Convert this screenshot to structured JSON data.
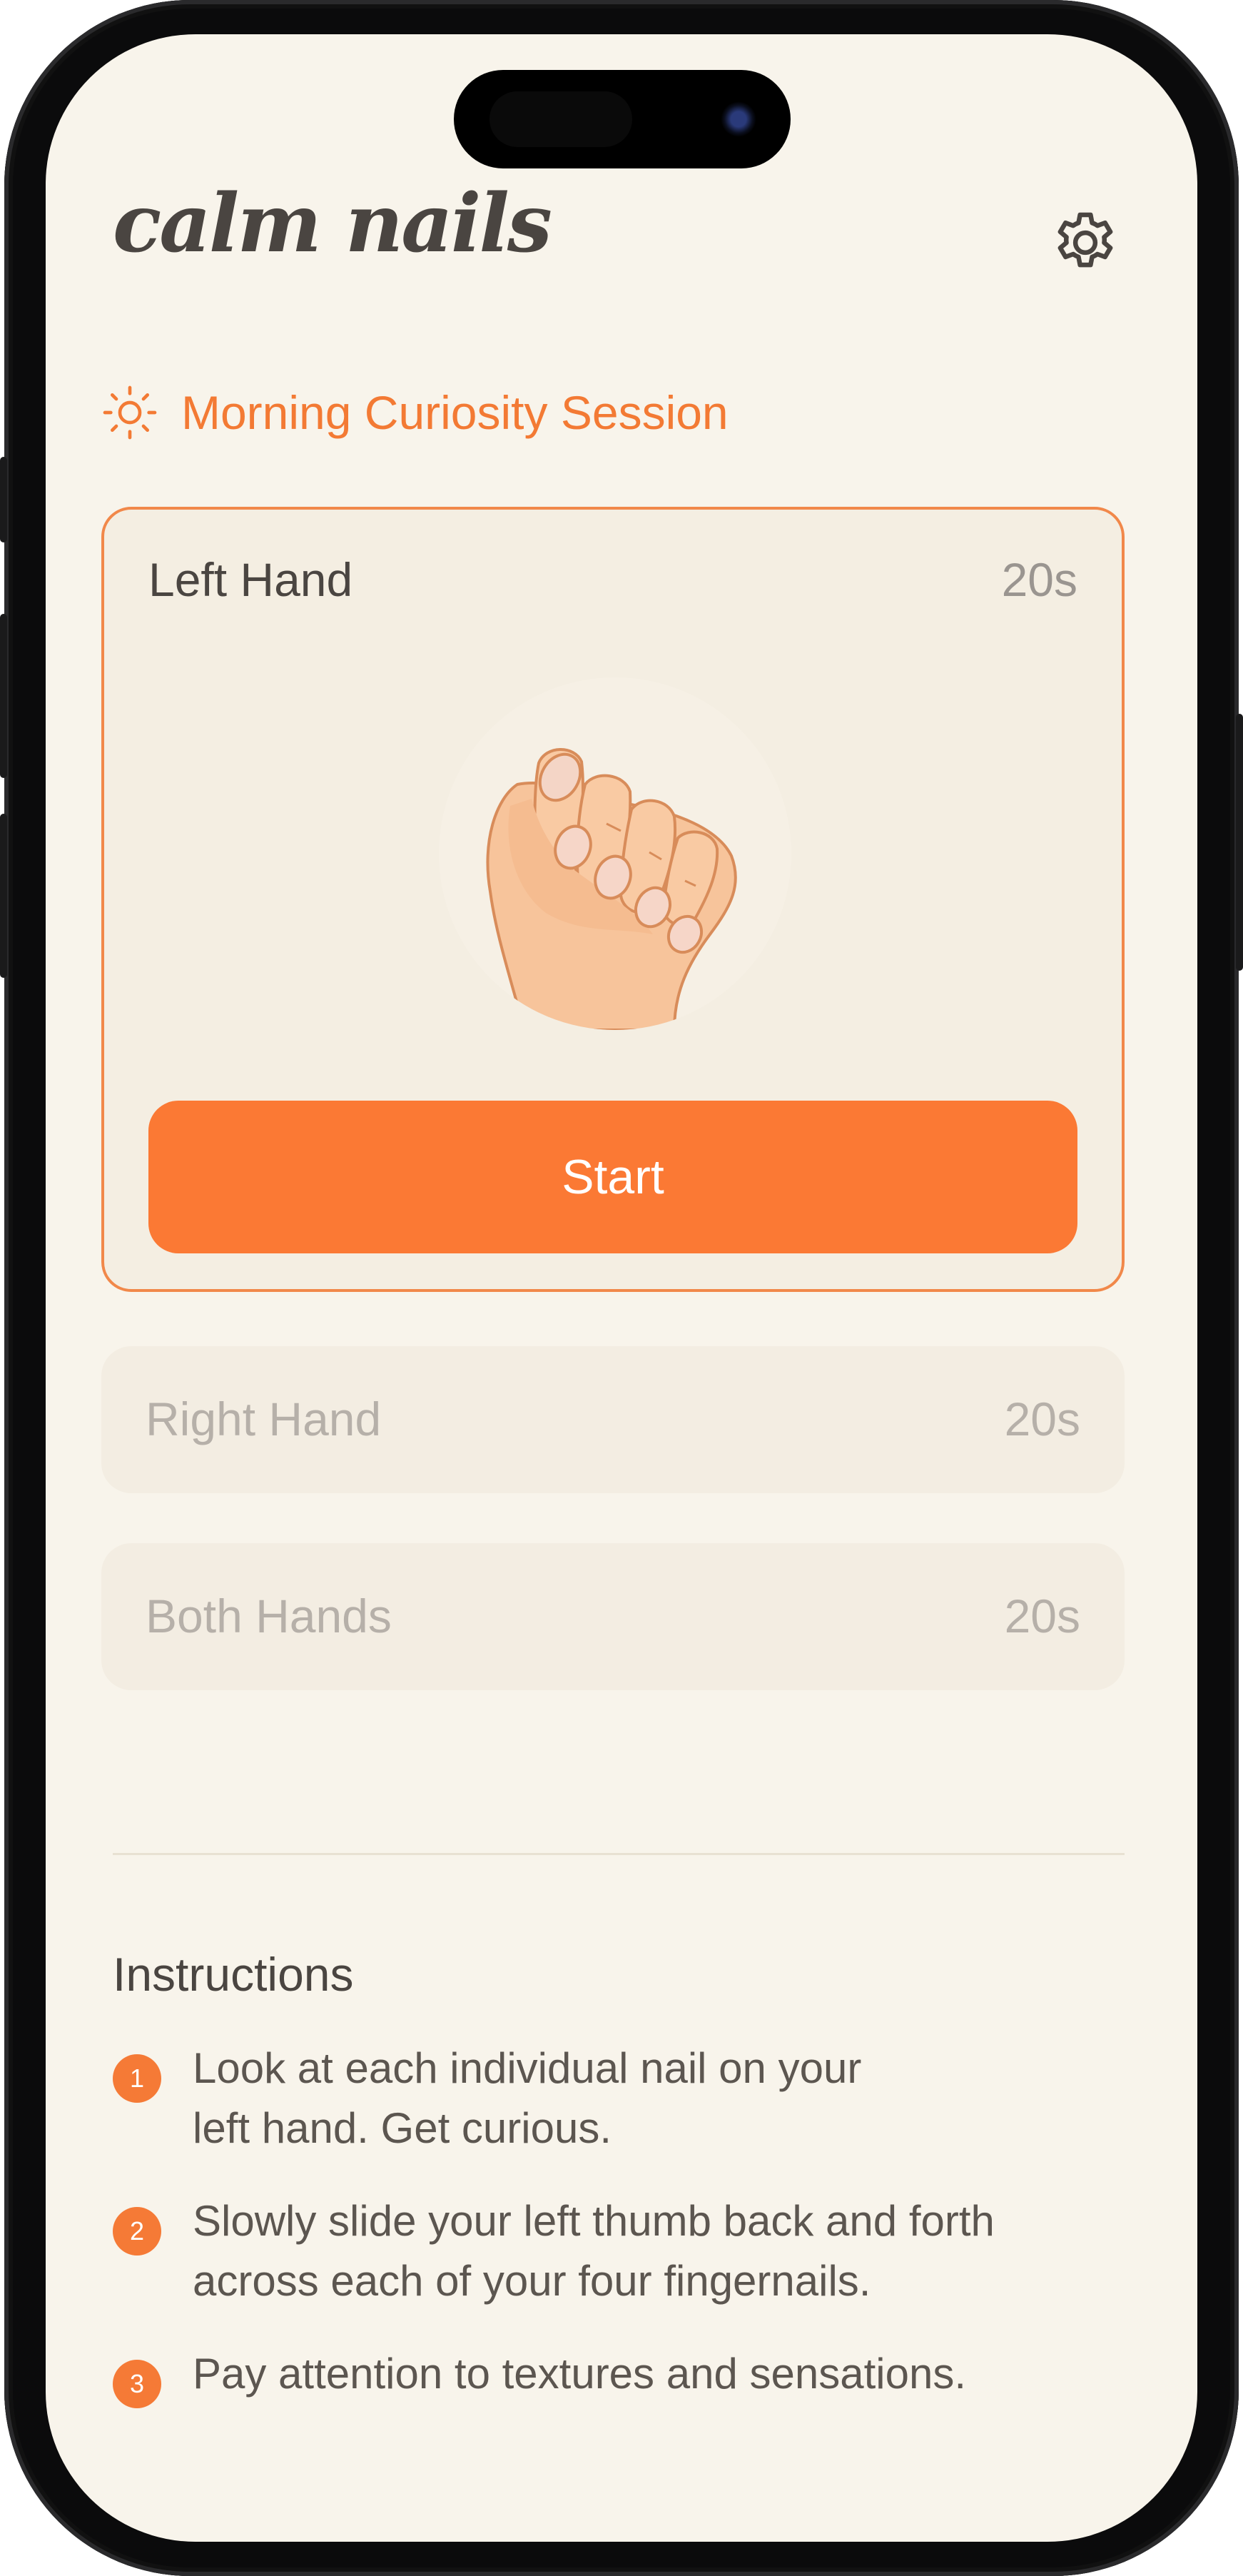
{
  "app": {
    "title": "calm nails"
  },
  "icons": {
    "settings": "gear-icon",
    "session": "sun-icon",
    "hand": "fist-hand-illustration"
  },
  "colors": {
    "accent": "#fb7934",
    "background": "#f8f4eb",
    "card": "#f4eee2",
    "text": "#4a4541",
    "muted": "#b6b0a9"
  },
  "session": {
    "title": "Morning Curiosity Session"
  },
  "exercises": [
    {
      "label": "Left Hand",
      "duration": "20s",
      "active": true,
      "action": "Start"
    },
    {
      "label": "Right Hand",
      "duration": "20s",
      "active": false
    },
    {
      "label": "Both Hands",
      "duration": "20s",
      "active": false
    }
  ],
  "instructions": {
    "title": "Instructions",
    "steps": [
      {
        "num": "1",
        "text": "Look at each individual nail on your\nleft hand. Get curious."
      },
      {
        "num": "2",
        "text": "Slowly slide your left thumb back and forth\nacross each of your four fingernails."
      },
      {
        "num": "3",
        "text": "Pay attention to textures and sensations."
      }
    ]
  }
}
